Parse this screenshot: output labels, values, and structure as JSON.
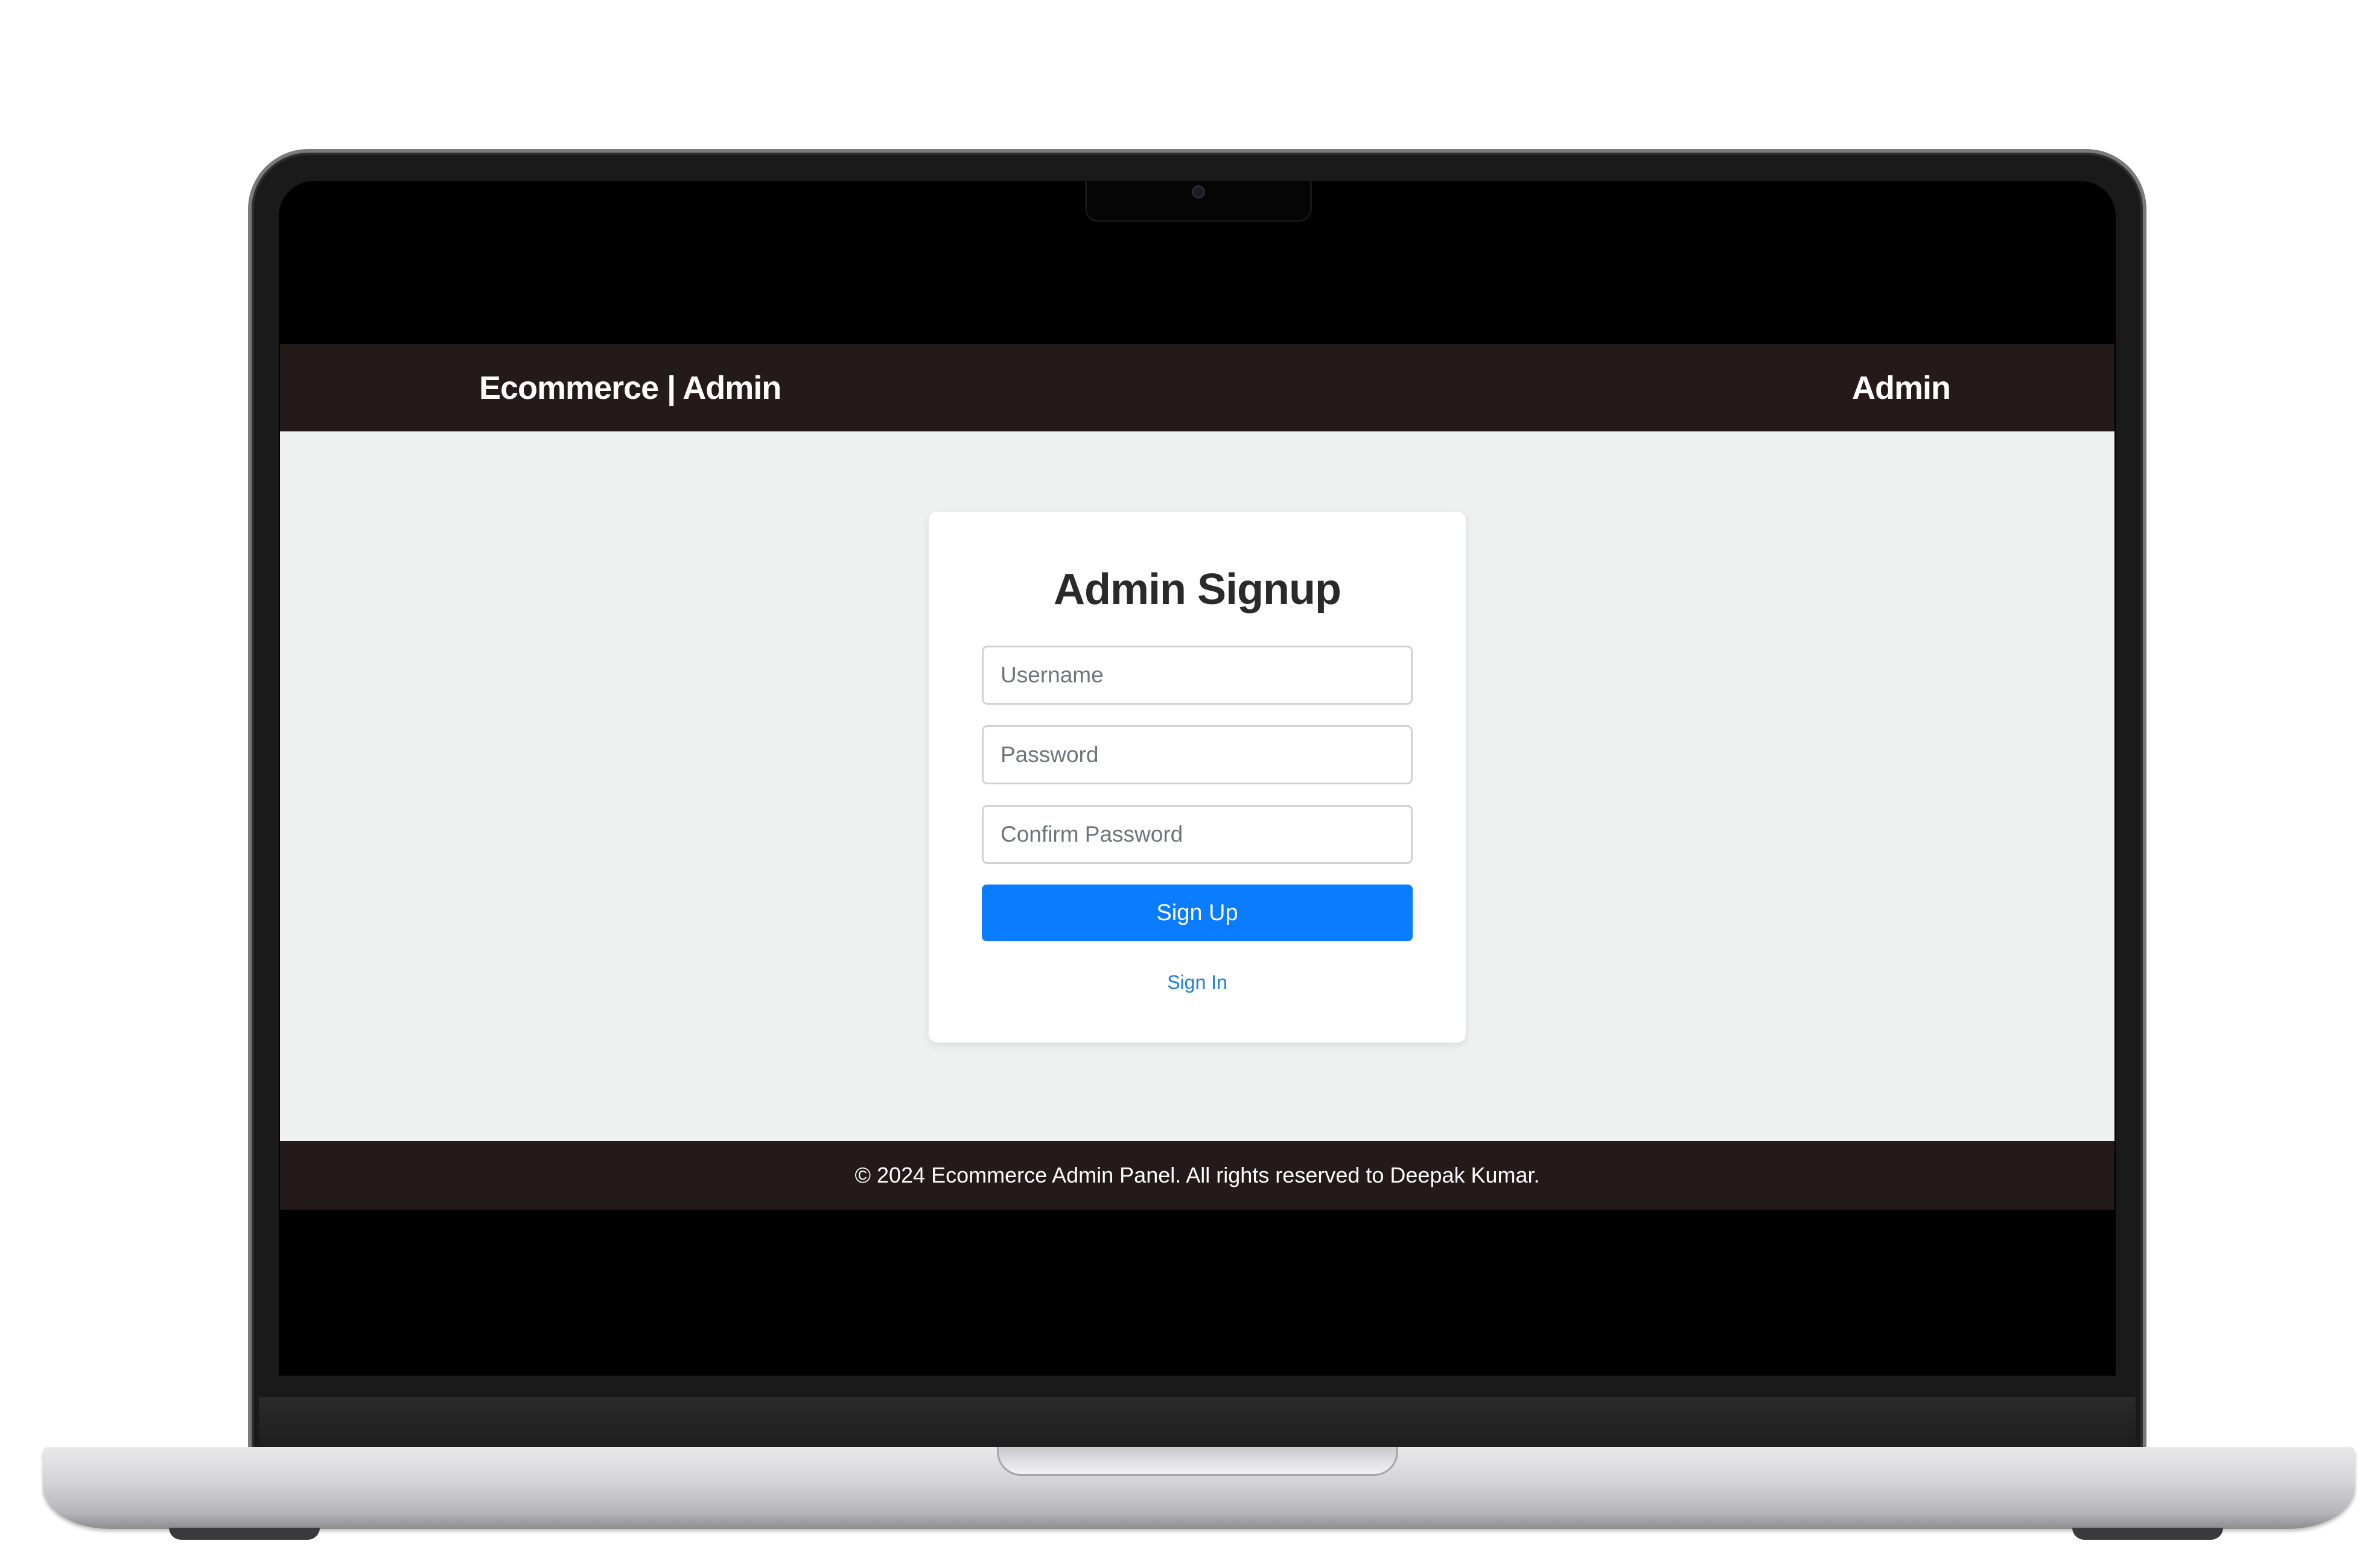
{
  "navbar": {
    "brand": "Ecommerce | Admin",
    "right_link": "Admin"
  },
  "signup_form": {
    "title": "Admin Signup",
    "username_placeholder": "Username",
    "password_placeholder": "Password",
    "confirm_password_placeholder": "Confirm Password",
    "submit_label": "Sign Up",
    "signin_link": "Sign In"
  },
  "footer": {
    "text": "© 2024 Ecommerce Admin Panel. All rights reserved to Deepak Kumar."
  },
  "colors": {
    "navbar_bg": "#231a19",
    "page_bg": "#eef1f0",
    "primary": "#0a7cff",
    "link": "#1f7fe0"
  }
}
